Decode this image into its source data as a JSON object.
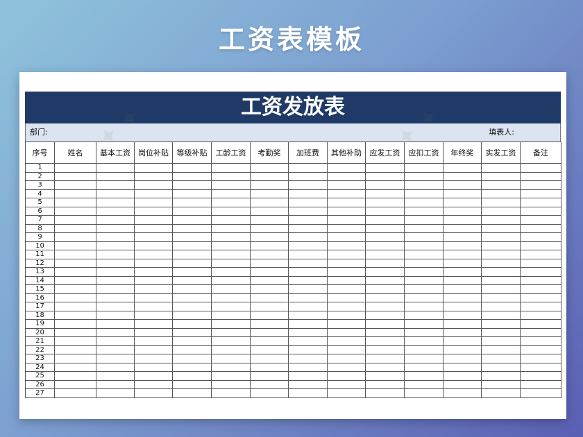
{
  "page": {
    "banner_title": "工资表模板"
  },
  "form": {
    "title": "工资发放表",
    "department_label": "部门:",
    "filler_label": "填表人:"
  },
  "table": {
    "columns": [
      "序号",
      "姓名",
      "基本工资",
      "岗位补贴",
      "等级补贴",
      "工龄工资",
      "考勤奖",
      "加班费",
      "其他补助",
      "应发工资",
      "应扣工资",
      "年终奖",
      "实发工资",
      "备注"
    ],
    "row_numbers": [
      "1",
      "2",
      "3",
      "4",
      "5",
      "6",
      "7",
      "8",
      "9",
      "10",
      "11",
      "12",
      "13",
      "14",
      "15",
      "16",
      "17",
      "18",
      "19",
      "20",
      "21",
      "22",
      "23",
      "24",
      "25",
      "26",
      "27"
    ]
  },
  "colors": {
    "title_bar": "#1f3a66",
    "meta_row": "#dbe4f0",
    "background_start": "#8fc3dc",
    "background_end": "#5a5fb3"
  }
}
